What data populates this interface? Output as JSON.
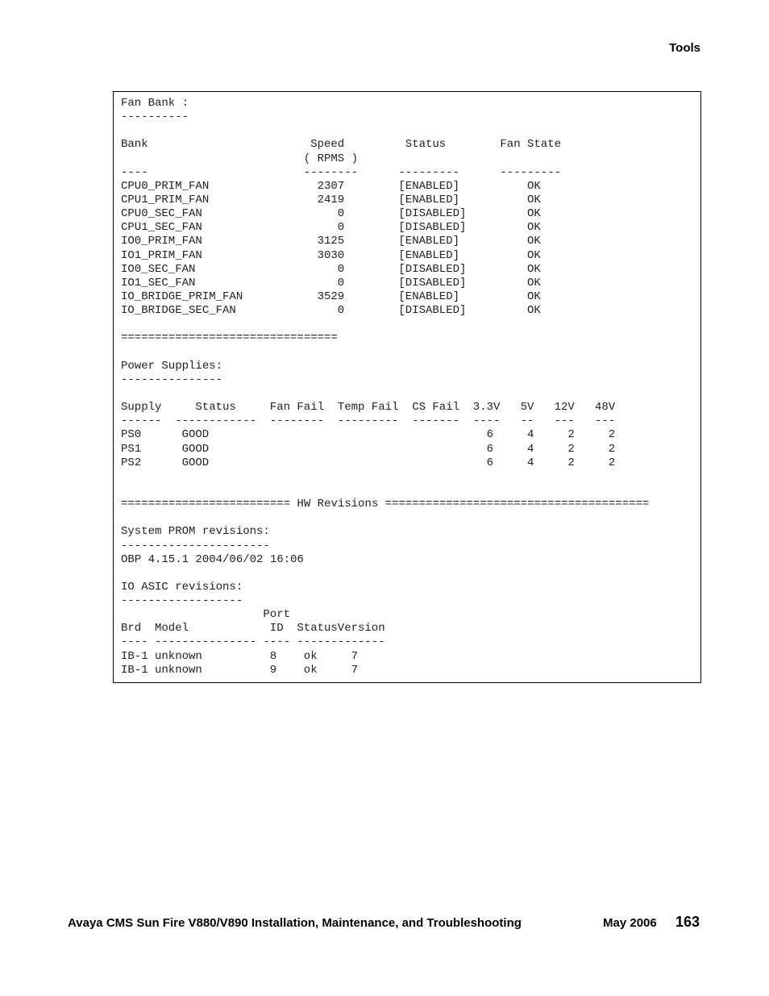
{
  "header": {
    "section": "Tools"
  },
  "footer": {
    "title": "Avaya CMS Sun Fire V880/V890 Installation, Maintenance, and Troubleshooting",
    "date": "May 2006",
    "page": "163"
  },
  "fan_bank": {
    "title": "Fan Bank :",
    "underline": "----------",
    "columns": {
      "bank": "Bank",
      "speed": "Speed",
      "speed_unit": "( RPMS )",
      "status": "Status",
      "fan_state": "Fan State"
    },
    "dashes": {
      "bank": "----",
      "speed": "--------",
      "status": "---------",
      "fan_state": "---------"
    },
    "rows": [
      {
        "bank": "CPU0_PRIM_FAN",
        "speed": "2307",
        "status": "[ENABLED]",
        "fan_state": "OK"
      },
      {
        "bank": "CPU1_PRIM_FAN",
        "speed": "2419",
        "status": "[ENABLED]",
        "fan_state": "OK"
      },
      {
        "bank": "CPU0_SEC_FAN",
        "speed": "0",
        "status": "[DISABLED]",
        "fan_state": "OK"
      },
      {
        "bank": "CPU1_SEC_FAN",
        "speed": "0",
        "status": "[DISABLED]",
        "fan_state": "OK"
      },
      {
        "bank": "IO0_PRIM_FAN",
        "speed": "3125",
        "status": "[ENABLED]",
        "fan_state": "OK"
      },
      {
        "bank": "IO1_PRIM_FAN",
        "speed": "3030",
        "status": "[ENABLED]",
        "fan_state": "OK"
      },
      {
        "bank": "IO0_SEC_FAN",
        "speed": "0",
        "status": "[DISABLED]",
        "fan_state": "OK"
      },
      {
        "bank": "IO1_SEC_FAN",
        "speed": "0",
        "status": "[DISABLED]",
        "fan_state": "OK"
      },
      {
        "bank": "IO_BRIDGE_PRIM_FAN",
        "speed": "3529",
        "status": "[ENABLED]",
        "fan_state": "OK"
      },
      {
        "bank": "IO_BRIDGE_SEC_FAN",
        "speed": "0",
        "status": "[DISABLED]",
        "fan_state": "OK"
      }
    ],
    "separator": "================================"
  },
  "power": {
    "title": "Power Supplies:",
    "underline": "---------------",
    "columns": {
      "supply": "Supply",
      "status": "Status",
      "fan_fail": "Fan Fail",
      "temp_fail": "Temp Fail",
      "cs_fail": "CS Fail",
      "v33": "3.3V",
      "v5": "5V",
      "v12": "12V",
      "v48": "48V"
    },
    "dashes": {
      "supply": "------",
      "status": "------------",
      "fan_fail": "--------",
      "temp_fail": "---------",
      "cs_fail": "-------",
      "v33": "----",
      "v5": "--",
      "v12": "---",
      "v48": "---"
    },
    "rows": [
      {
        "supply": "PS0",
        "status": "GOOD",
        "v33": "6",
        "v5": "4",
        "v12": "2",
        "v48": "2"
      },
      {
        "supply": "PS1",
        "status": "GOOD",
        "v33": "6",
        "v5": "4",
        "v12": "2",
        "v48": "2"
      },
      {
        "supply": "PS2",
        "status": "GOOD",
        "v33": "6",
        "v5": "4",
        "v12": "2",
        "v48": "2"
      }
    ]
  },
  "hw": {
    "banner": "========================= HW Revisions =======================================",
    "prom_title": "System PROM revisions:",
    "prom_underline": "----------------------",
    "obp": "OBP 4.15.1 2004/06/02 16:06",
    "asic_title": "IO ASIC revisions:",
    "asic_underline": "------------------",
    "columns": {
      "port": "Port",
      "brd": "Brd",
      "model": "Model",
      "id": "ID",
      "status": "Status",
      "version": "Version"
    },
    "dashes": {
      "brd": "----",
      "model": "---------------",
      "id": "----",
      "status": "------",
      "version": "-------"
    },
    "rows": [
      {
        "brd": "IB-1",
        "model": "unknown",
        "id": "8",
        "status": "ok",
        "version": "7"
      },
      {
        "brd": "IB-1",
        "model": "unknown",
        "id": "9",
        "status": "ok",
        "version": "7"
      }
    ]
  }
}
